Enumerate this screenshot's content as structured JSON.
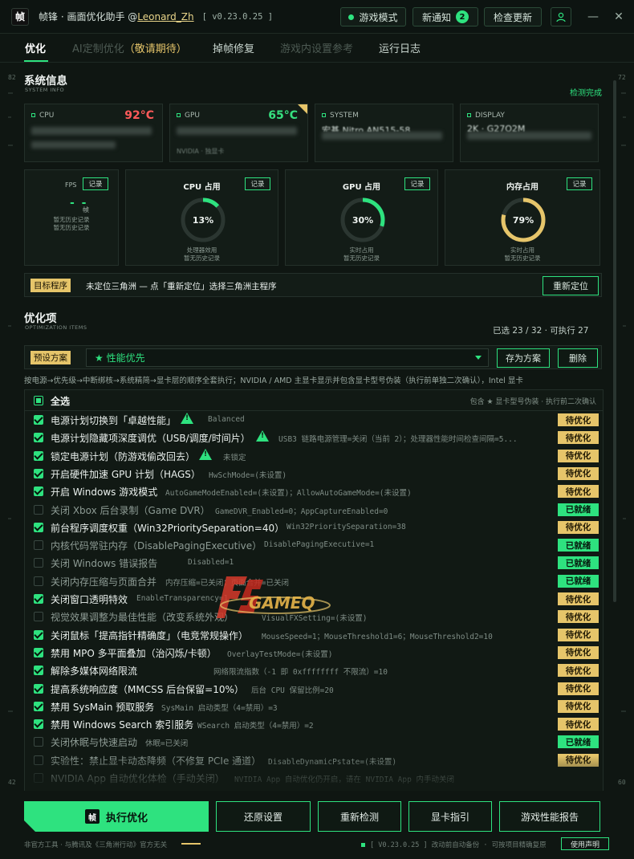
{
  "titlebar": {
    "logo_char": "帧",
    "app_name": "帧锋 · 画面优化助手 @",
    "author": "Leonard_Zh",
    "version": "[ v0.23.0.25 ]",
    "game_mode_label": "游戏模式",
    "notice_label": "新通知",
    "notice_count": "2",
    "check_update_label": "检查更新",
    "minimize_glyph": "—",
    "close_glyph": "✕"
  },
  "tabs": [
    {
      "label": "优化"
    },
    {
      "label": "AI定制优化"
    },
    {
      "label": "（敬请期待）"
    },
    {
      "label": "掉帧修复"
    },
    {
      "label": "游戏内设置参考"
    },
    {
      "label": "运行日志"
    }
  ],
  "rulers": {
    "left_top": "82",
    "right_top": "72",
    "left_bottom": "42",
    "right_bottom": "60"
  },
  "system_info": {
    "title": "系统信息",
    "subtitle": "SYSTEM INFO",
    "status": "检测完成",
    "cards": [
      {
        "label": "CPU",
        "temp": "92°C",
        "temp_color": "#ff5a5a"
      },
      {
        "label": "GPU",
        "temp": "65°C",
        "temp_color": "#36e07f",
        "value": "NVIDIA · 独显卡"
      },
      {
        "label": "SYSTEM",
        "value": "宏碁 Nitro AN515-58"
      },
      {
        "label": "DISPLAY",
        "value": "2K · G27Q2M"
      }
    ]
  },
  "monitors": {
    "fps": {
      "title": "FPS",
      "value": "- -",
      "unit": "帧",
      "note1": "暂无历史记录",
      "note2": "暂无历史记录",
      "record_label": "记录"
    },
    "cpu": {
      "title": "CPU 占用",
      "value": "13%",
      "percent": 13,
      "note1": "处理器效用",
      "note2": "暂无历史记录",
      "record_label": "记录",
      "color": "#2ee27f"
    },
    "gpu": {
      "title": "GPU 占用",
      "value": "30%",
      "percent": 30,
      "note1": "实时占用",
      "note2": "暂无历史记录",
      "record_label": "记录",
      "color": "#2ee27f"
    },
    "mem": {
      "title": "内存占用",
      "value": "79%",
      "percent": 79,
      "note1": "实时占用",
      "note2": "暂无历史记录",
      "record_label": "记录",
      "color": "#e6c56a"
    }
  },
  "target": {
    "tag": "目标程序",
    "text": "未定位三角洲 — 点「重新定位」选择三角洲主程序",
    "relocate_label": "重新定位"
  },
  "optimization": {
    "title": "优化项",
    "subtitle": "OPTIMIZATION ITEMS",
    "count_text": "已选 23 / 32 · 可执行 27",
    "preset_tag": "预设方案",
    "preset_value": "★ 性能优先",
    "save_preset_label": "存为方案",
    "delete_label": "删除",
    "description": "按电源→优先级→中断绑核→系统精简→显卡层的顺序全套执行；NVIDIA / AMD 主显卡显示并包含显卡型号伪装（执行前单独二次确认），Intel 显卡",
    "select_all_label": "全选",
    "select_all_note": "包含 ★ 显卡型号伪装 · 执行前二次确认"
  },
  "items": [
    {
      "name": "电源计划切换到「卓越性能」",
      "detail": "Balanced",
      "checked": true,
      "warn": true,
      "status": "待优化"
    },
    {
      "name": "电源计划隐藏项深度调优（USB/调度/时间片）",
      "detail": "USB3 链路电源管理=关闭（当前 2）；处理器性能时间检查间隔=5...",
      "checked": true,
      "warn": true,
      "status": "待优化"
    },
    {
      "name": "锁定电源计划（防游戏偷改回去）",
      "detail": "未锁定",
      "checked": true,
      "warn": true,
      "status": "待优化"
    },
    {
      "name": "开启硬件加速 GPU 计划（HAGS）",
      "detail": "HwSchMode=(未设置)",
      "checked": true,
      "warn": false,
      "status": "待优化"
    },
    {
      "name": "开启 Windows 游戏模式",
      "detail": "AutoGameModeEnabled=(未设置)；AllowAutoGameMode=(未设置)",
      "checked": true,
      "warn": false,
      "status": "待优化"
    },
    {
      "name": "关闭 Xbox 后台录制（Game DVR）",
      "detail": "GameDVR_Enabled=0；AppCaptureEnabled=0",
      "checked": false,
      "warn": false,
      "status": "已就绪"
    },
    {
      "name": "前台程序调度权重（Win32PrioritySeparation=40）",
      "detail": "Win32PrioritySeparation=38",
      "checked": true,
      "warn": false,
      "status": "待优化"
    },
    {
      "name": "内核代码常驻内存（DisablePagingExecutive）",
      "detail": "DisablePagingExecutive=1",
      "checked": false,
      "warn": false,
      "status": "已就绪"
    },
    {
      "name": "关闭 Windows 错误报告",
      "detail": "Disabled=1",
      "checked": false,
      "warn": false,
      "status": "已就绪"
    },
    {
      "name": "关闭内存压缩与页面合并",
      "detail": "内存压缩=已关闭；页面合并=已关闭",
      "checked": false,
      "warn": false,
      "status": "已就绪"
    },
    {
      "name": "关闭窗口透明特效",
      "detail": "EnableTransparency=1",
      "checked": true,
      "warn": false,
      "status": "待优化"
    },
    {
      "name": "视觉效果调整为最佳性能（改变系统外观）",
      "detail": "VisualFXSetting=(未设置)",
      "checked": false,
      "warn": false,
      "status": "待优化"
    },
    {
      "name": "关闭鼠标「提高指针精确度」（电竞常规操作）",
      "detail": "MouseSpeed=1；MouseThreshold1=6；MouseThreshold2=10",
      "checked": true,
      "warn": false,
      "status": "待优化"
    },
    {
      "name": "禁用 MPO 多平面叠加（治闪烁/卡顿）",
      "detail": "OverlayTestMode=(未设置)",
      "checked": true,
      "warn": false,
      "status": "待优化"
    },
    {
      "name": "解除多媒体网络限流",
      "detail": "网络限流指数（-1 即 0xffffffff 不限流）=10",
      "checked": true,
      "warn": false,
      "status": "待优化"
    },
    {
      "name": "提高系统响应度（MMCSS 后台保留=10%）",
      "detail": "后台 CPU 保留比例=20",
      "checked": true,
      "warn": false,
      "status": "待优化"
    },
    {
      "name": "禁用 SysMain 预取服务",
      "detail": "SysMain 启动类型（4=禁用）=3",
      "checked": true,
      "warn": false,
      "status": "待优化"
    },
    {
      "name": "禁用 Windows Search 索引服务",
      "detail": "WSearch 启动类型（4=禁用）=2",
      "checked": true,
      "warn": false,
      "status": "待优化"
    },
    {
      "name": "关闭休眠与快速启动",
      "detail": "休眠=已关闭",
      "checked": false,
      "warn": false,
      "status": "已就绪"
    },
    {
      "name": "实验性：禁止显卡动态降频（不修复 PCIe 通道）",
      "detail": "DisableDynamicPstate=(未设置)",
      "checked": false,
      "warn": false,
      "status": "待优化"
    },
    {
      "name": "NVIDIA App 自动优化体检（手动关闭）",
      "detail": "NVIDIA App 自动优化仍开启，请在 NVIDIA App 内手动关闭",
      "checked": false,
      "warn": false,
      "status": ""
    }
  ],
  "watermark": {
    "text": "GAMEQ"
  },
  "actions": {
    "execute_label": "执行优化",
    "restore_label": "还原设置",
    "redetect_label": "重新检测",
    "gpu_guide_label": "显卡指引",
    "report_label": "游戏性能报告"
  },
  "footer": {
    "left": "非官方工具 · 与腾讯及《三角洲行动》官方无关",
    "right": "[ V0.23.0.25 ]  改动前自动备份 · 可按项目精确复原",
    "usage_label": "使用声明"
  },
  "colors": {
    "accent": "#2ee27f",
    "gold": "#e6c56a",
    "hot": "#ff5a5a"
  }
}
